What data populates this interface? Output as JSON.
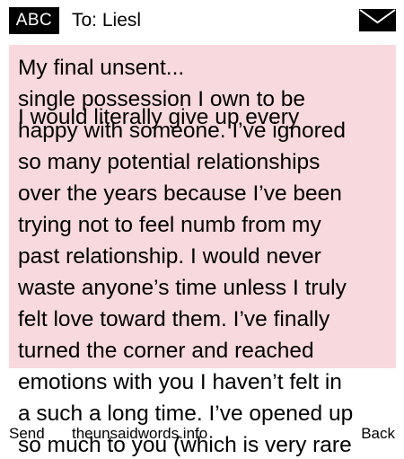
{
  "header": {
    "input_mode": "ABC",
    "to_label": "To: Liesl",
    "envelope_icon": "envelope-icon"
  },
  "message": {
    "draft_lines": [
      "My final unsent...",
      "single possession I own to be"
    ],
    "body_lines": [
      "I would literally give up every",
      "happy with someone. I’ve ignored",
      "so many potential relationships",
      "over the years because I’ve been",
      "trying not to feel numb from my",
      "past relationship. I would never",
      "waste anyone’s time unless I truly",
      "felt love toward them. I’ve finally",
      "turned the corner and reached",
      "emotions with you I haven’t felt in",
      "a such a long time. I’ve opened up",
      "so much to you (which is very rare"
    ]
  },
  "footer": {
    "send": "Send",
    "site": "theunsaidwords.info",
    "back": "Back"
  }
}
